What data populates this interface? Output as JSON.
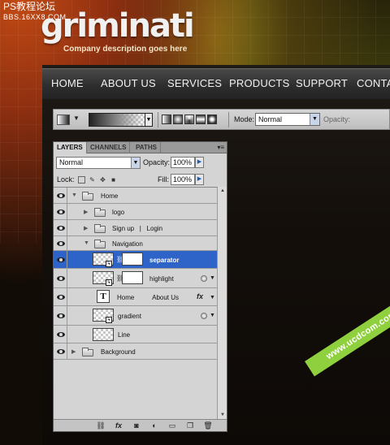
{
  "watermark_top": {
    "line1": "PS教程论坛",
    "line2": "BBS.16XX8.COM"
  },
  "site": {
    "logo": "griminati",
    "tagline": "Company description goes here",
    "nav": [
      "HOME",
      "ABOUT US",
      "SERVICES",
      "PRODUCTS",
      "SUPPORT",
      "CONTAC"
    ]
  },
  "options_bar": {
    "mode_label": "Mode:",
    "mode_value": "Normal",
    "opacity_label": "Opacity:"
  },
  "layers_panel": {
    "tabs": [
      "LAYERS",
      "CHANNELS",
      "PATHS"
    ],
    "blend_mode": "Normal",
    "opacity_label": "Opacity:",
    "opacity_value": "100%",
    "lock_label": "Lock:",
    "fill_label": "Fill:",
    "fill_value": "100%",
    "layers": [
      {
        "name": "Home",
        "type": "group",
        "expanded": true,
        "visible": true
      },
      {
        "name": "logo",
        "type": "group",
        "expanded": false,
        "visible": true
      },
      {
        "name": "Sign up   |   Login",
        "type": "group",
        "expanded": false,
        "visible": true
      },
      {
        "name": "Navigation",
        "type": "group",
        "expanded": true,
        "visible": true
      },
      {
        "name": "separator",
        "type": "layer-with-mask",
        "selected": true,
        "visible": true
      },
      {
        "name": "highlight",
        "type": "layer-with-mask",
        "visible": true,
        "has_effects": true
      },
      {
        "name": "Home          About Us",
        "type": "text",
        "visible": true,
        "has_effects": true,
        "fx": "fx"
      },
      {
        "name": "gradient",
        "type": "smart-object",
        "visible": true,
        "has_effects": true
      },
      {
        "name": "Line",
        "type": "layer",
        "visible": true
      },
      {
        "name": "Background",
        "type": "group",
        "expanded": false,
        "visible": true
      }
    ],
    "bottom_icons": [
      "link-icon",
      "fx-icon",
      "mask-icon",
      "adjustment-icon",
      "new-group-icon",
      "new-layer-icon",
      "trash-icon"
    ]
  },
  "watermark_badge": "www.ucdcom.com",
  "colors": {
    "selection": "#2e64c8",
    "watermark_green": "#8fd03e"
  }
}
